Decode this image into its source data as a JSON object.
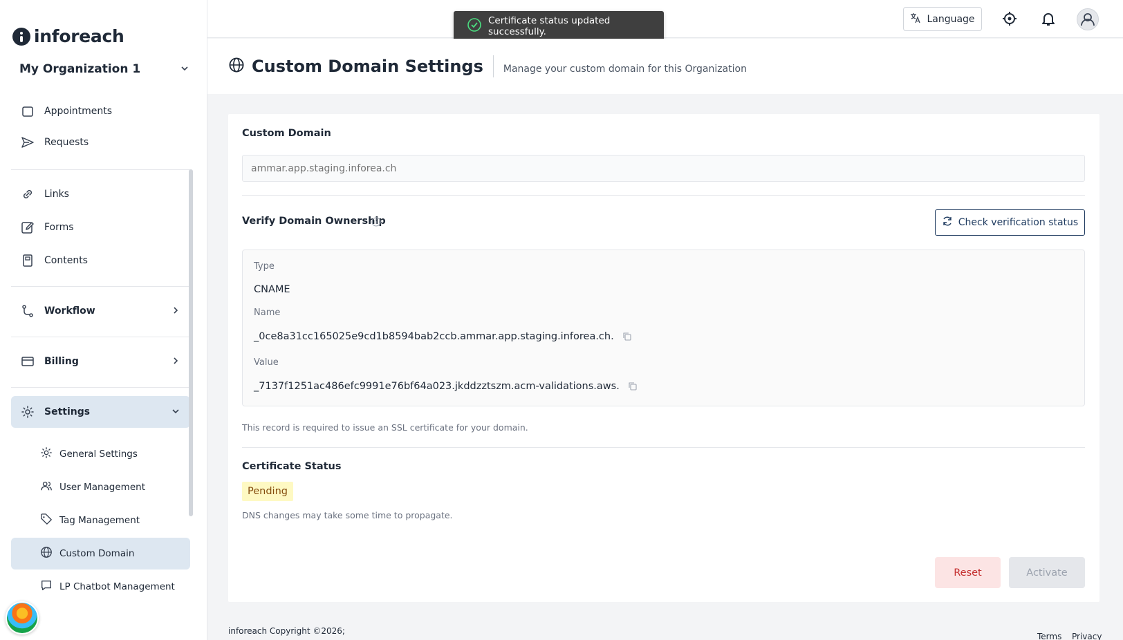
{
  "brand": {
    "logo_text": "inforeach"
  },
  "org": {
    "name": "My Organization 1"
  },
  "sidebar": {
    "items": [
      {
        "key": "appointments",
        "label": "Appointments"
      },
      {
        "key": "requests",
        "label": "Requests"
      },
      {
        "key": "links",
        "label": "Links"
      },
      {
        "key": "forms",
        "label": "Forms"
      },
      {
        "key": "contents",
        "label": "Contents"
      },
      {
        "key": "workflow",
        "label": "Workflow"
      },
      {
        "key": "billing",
        "label": "Billing"
      },
      {
        "key": "settings",
        "label": "Settings"
      }
    ],
    "settings_sub": [
      {
        "label": "General Settings"
      },
      {
        "label": "User Management"
      },
      {
        "label": "Tag Management"
      },
      {
        "label": "Custom Domain"
      },
      {
        "label": "LP Chatbot Management"
      }
    ]
  },
  "topbar": {
    "language_label": "Language"
  },
  "toast": {
    "message": "Certificate status updated successfully."
  },
  "page": {
    "title": "Custom Domain Settings",
    "subtitle": "Manage your custom domain for this Organization"
  },
  "custom_domain": {
    "label": "Custom Domain",
    "placeholder": "ammar.app.staging.inforea.ch"
  },
  "verify": {
    "label": "Verify Domain Ownership",
    "check_button": "Check verification status",
    "type_label": "Type",
    "type_value": "CNAME",
    "name_label": "Name",
    "name_value": "_0ce8a31cc165025e9cd1b8594bab2ccb.ammar.app.staging.inforea.ch.",
    "value_label": "Value",
    "value_value": "_7137f1251ac486efc9991e76bf64a023.jkddzztszm.acm-validations.aws.",
    "help": "This record is required to issue an SSL certificate for your domain."
  },
  "certificate": {
    "label": "Certificate Status",
    "status": "Pending",
    "help": "DNS changes may take some time to propagate."
  },
  "actions": {
    "reset": "Reset",
    "activate": "Activate"
  },
  "footer": {
    "copyright": "inforeach Copyright ©2026;",
    "terms": "Terms",
    "privacy": "Privacy"
  },
  "colors": {
    "accent": "#1e3a5f",
    "active_bg": "#dde7f1",
    "pending_bg": "#fef9c3",
    "reset_bg": "#fce4e4",
    "reset_text": "#c53030"
  }
}
